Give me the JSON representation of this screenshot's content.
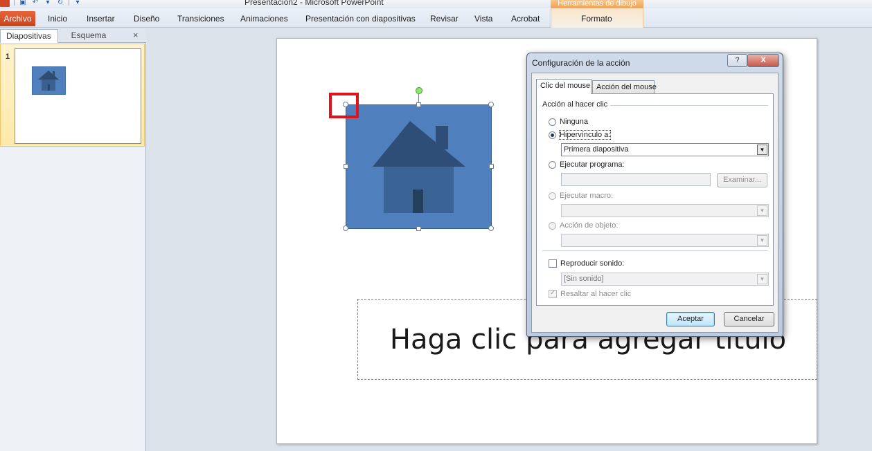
{
  "window": {
    "title": "Presentación2 - Microsoft PowerPoint",
    "context_tab_group": "Herramientas de dibujo"
  },
  "ribbon": {
    "file_tab": "Archivo",
    "tabs": [
      "Inicio",
      "Insertar",
      "Diseño",
      "Transiciones",
      "Animaciones",
      "Presentación con diapositivas",
      "Revisar",
      "Vista",
      "Acrobat"
    ],
    "context_tab": "Formato"
  },
  "left_panel": {
    "tabs": [
      "Diapositivas",
      "Esquema"
    ],
    "close_glyph": "×",
    "slide_number": "1"
  },
  "slide": {
    "title_placeholder": "Haga clic para agregar título",
    "shape_icon": "house-icon",
    "shape_color": "#4f80bd"
  },
  "dialog": {
    "title": "Configuración de la acción",
    "help_glyph": "?",
    "close_glyph": "X",
    "tabs": [
      "Clic del mouse",
      "Acción del mouse"
    ],
    "group_label": "Acción al hacer clic",
    "options": {
      "none": "Ninguna",
      "hyperlink": "Hipervínculo a:",
      "run_program": "Ejecutar programa:",
      "run_macro": "Ejecutar macro:",
      "object_action": "Acción de objeto:"
    },
    "hyperlink_value": "Primera diapositiva",
    "browse_button": "Examinar...",
    "play_sound_label": "Reproducir sonido:",
    "sound_value": "[Sin sonido]",
    "highlight_label": "Resaltar al hacer clic",
    "ok_button": "Aceptar",
    "cancel_button": "Cancelar"
  }
}
